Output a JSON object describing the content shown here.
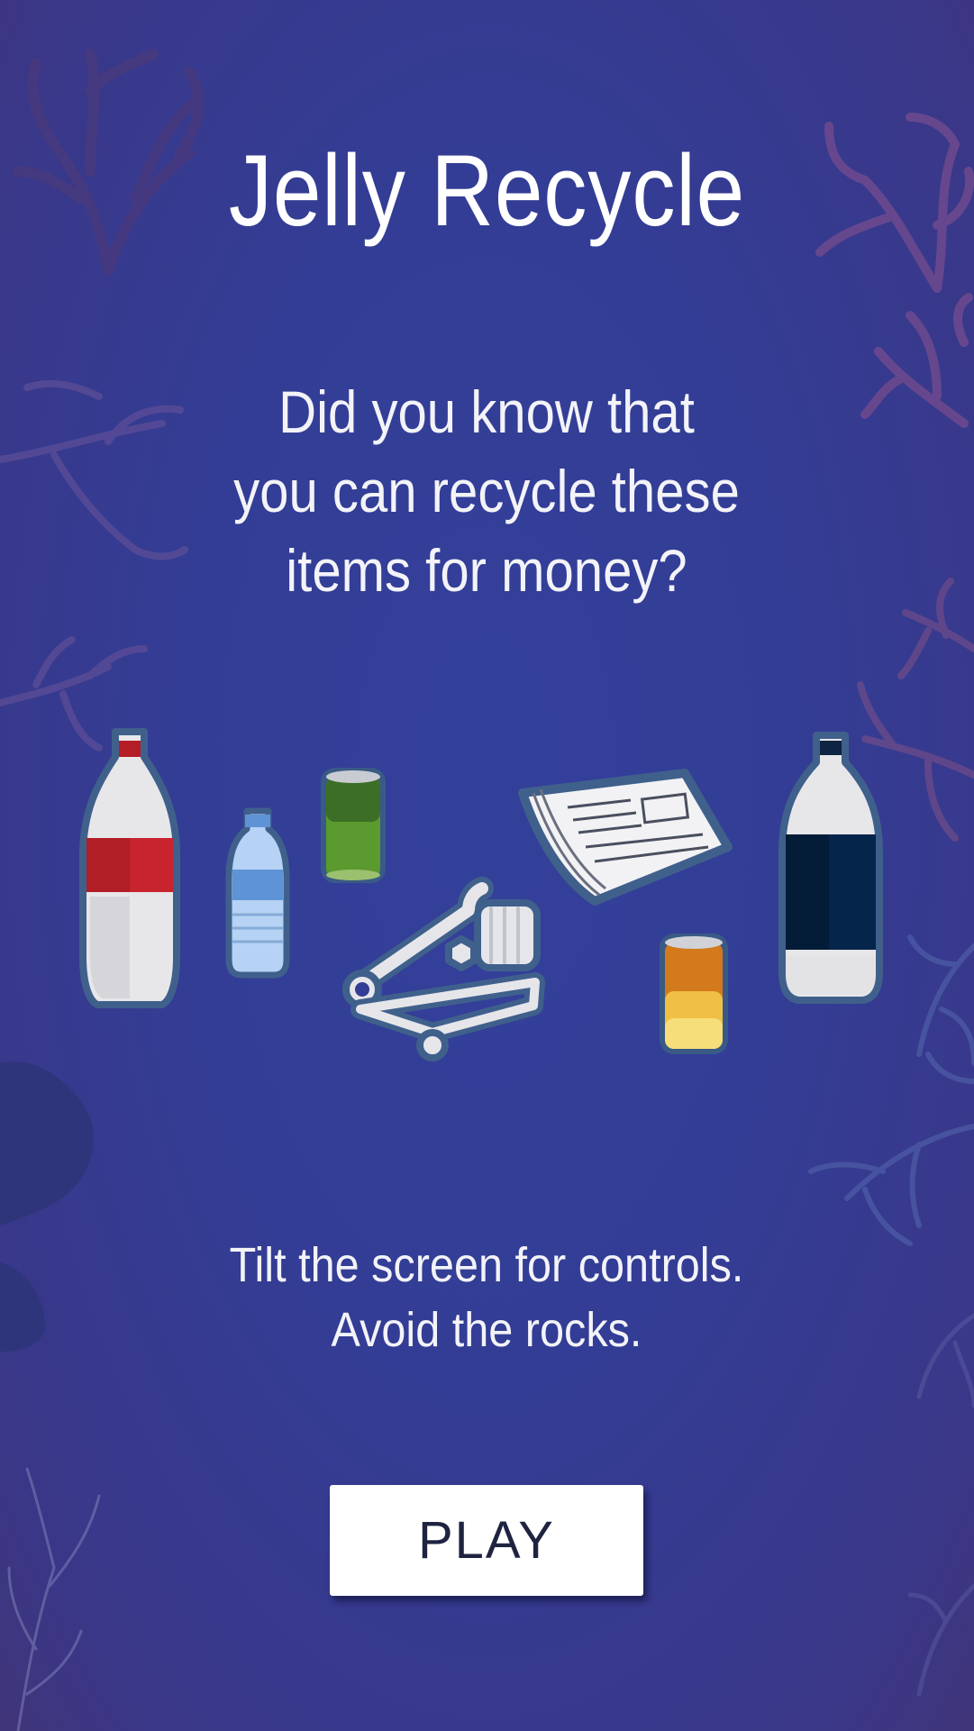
{
  "game": {
    "title": "Jelly Recycle",
    "question_lines": [
      "Did you know that",
      "you can recycle these",
      "items for money?"
    ],
    "instruction_lines": [
      "Tilt the screen for controls.",
      "Avoid the rocks."
    ],
    "play_label": "PLAY"
  },
  "recyclables": [
    {
      "name": "cola-bottle",
      "icon": "red-label-plastic-bottle"
    },
    {
      "name": "water-bottle",
      "icon": "water-bottle"
    },
    {
      "name": "green-can",
      "icon": "green-soda-can"
    },
    {
      "name": "scrap-metal",
      "icon": "wrench-bolt-spring-bike-frame"
    },
    {
      "name": "newspaper",
      "icon": "folded-newspaper"
    },
    {
      "name": "orange-can",
      "icon": "orange-soda-can"
    },
    {
      "name": "dark-bottle",
      "icon": "navy-label-plastic-bottle"
    }
  ],
  "colors": {
    "background": "#343d96",
    "coral": "#6a4a8a",
    "item_outline": "#3f5a86",
    "button_bg": "#ffffff",
    "button_text": "#1e2340",
    "cola_red": "#c8242e",
    "navy_label": "#06254a",
    "green_can": "#5b9a2e",
    "orange_can": "#d27a1c"
  }
}
